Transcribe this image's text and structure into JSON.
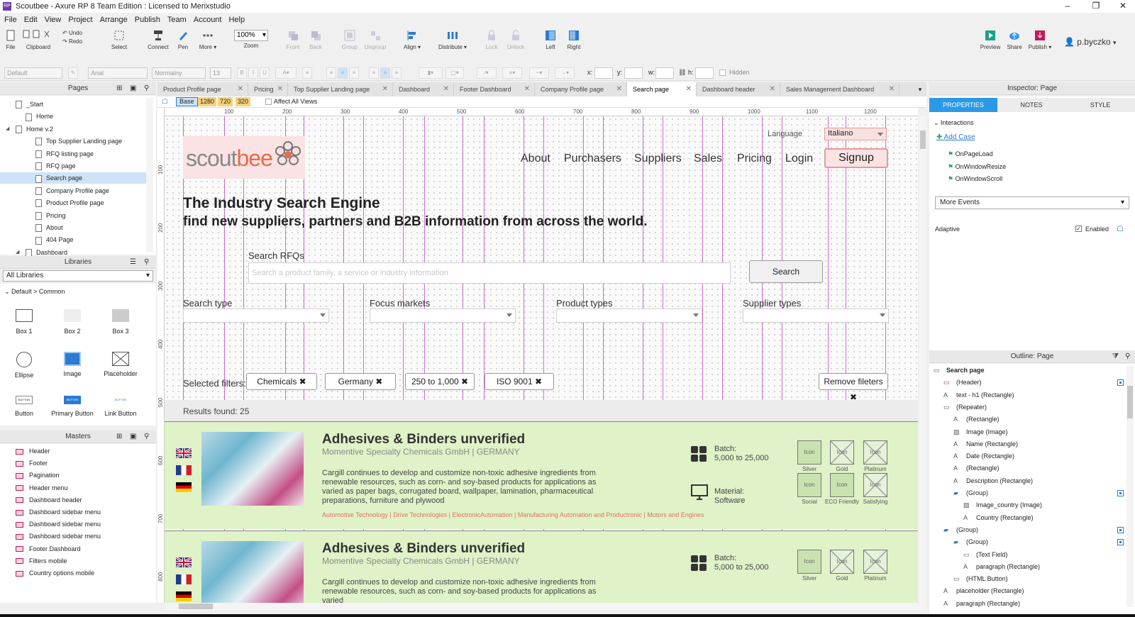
{
  "window": {
    "title": "Scoutbee - Axure RP 8 Team Edition : Licensed to Merixstudio",
    "minimize": "–",
    "restore": "❐",
    "close": "✕"
  },
  "menu": [
    "File",
    "Edit",
    "View",
    "Project",
    "Arrange",
    "Publish",
    "Team",
    "Account",
    "Help"
  ],
  "toolbar": {
    "file": "File",
    "clipboard": "Clipboard",
    "undo": "Undo",
    "redo": "Redo",
    "select": "Select",
    "connect": "Connect",
    "pen": "Pen",
    "more": "More ▾",
    "zoom_value": "100%",
    "zoom": "Zoom",
    "front": "Front",
    "back": "Back",
    "group": "Group",
    "ungroup": "Ungroup",
    "align": "Align ▾",
    "distribute": "Distribute ▾",
    "lock": "Lock",
    "unlock": "Unlock",
    "left": "Left",
    "right": "Right",
    "preview": "Preview",
    "share": "Share",
    "publish": "Publish ▾",
    "user": "p.byczko"
  },
  "format": {
    "style": "Default",
    "font": "Arial",
    "weight": "Normalny",
    "size": "13",
    "x": "x:",
    "y": "y:",
    "w": "w:",
    "h": "h:",
    "hidden": "Hidden"
  },
  "pages": {
    "title": "Pages",
    "items": [
      "_Start",
      "Home",
      "Home v.2",
      "Top Supplier Landing page",
      "RFQ listing page",
      "RFQ page",
      "Search page",
      "Company Profile page",
      "Product Profile page",
      "Pricing",
      "About",
      "404 Page",
      "Dashboard"
    ],
    "selected": "Search page"
  },
  "libraries": {
    "title": "Libraries",
    "select": "All Libraries",
    "group": "Default > Common",
    "items": [
      "Box 1",
      "Box 2",
      "Box 3",
      "Ellipse",
      "Image",
      "Placeholder",
      "Button",
      "Primary Button",
      "Link Button"
    ],
    "button_text": "BUTTON"
  },
  "masters": {
    "title": "Masters",
    "items": [
      "Header",
      "Footer",
      "Pagination",
      "Header menu",
      "Dashboard header",
      "Dashboard sidebar menu",
      "Dashboard sidebar menu",
      "Dashboard sidebar menu",
      "Footer Dashboard",
      "Filters mobile",
      "Country options mobile"
    ]
  },
  "tabs": [
    "Product Profile page",
    "Pricing",
    "Top Supplier Landing page",
    "Dashboard",
    "Footer Dashboard",
    "Company Profile page",
    "Search page",
    "Dashboard header",
    "Sales Management Dashboard"
  ],
  "active_tab": "Search page",
  "views": {
    "base": "Base",
    "v1": "1280",
    "v2": "720",
    "v3": "320",
    "affect": "Affect All Views"
  },
  "ruler_h": [
    "100",
    "200",
    "300",
    "400",
    "500",
    "600",
    "700",
    "800",
    "900",
    "1000",
    "1100",
    "1200"
  ],
  "ruler_v": [
    "100",
    "200",
    "300",
    "400",
    "500",
    "600",
    "700",
    "800"
  ],
  "page": {
    "language_label": "Language",
    "language_value": "Italiano",
    "logo_a": "scout",
    "logo_b": "bee",
    "nav": [
      "About",
      "Purchasers",
      "Suppliers",
      "Sales",
      "Pricing",
      "Login"
    ],
    "signup": "Signup",
    "h1": "The Industry Search Engine",
    "h2": "find new suppliers, partners and B2B information from across the world.",
    "search_label": "Search RFQs",
    "search_placeholder": "Search a product family, a service or industry information",
    "search_button": "Search",
    "filters": [
      "Search type",
      "Focus markets",
      "Product types",
      "Supplier types"
    ],
    "selected_filters_label": "Selected filters:",
    "chips": [
      "Chemicals ✖",
      "Germany ✖",
      "250 to 1,000 ✖",
      "ISO 9001 ✖"
    ],
    "remove_filters": "Remove fileters ✖",
    "results_found": "Results found: 25",
    "results": [
      {
        "title": "Adhesives & Binders unverified",
        "company": "Momentive Specialty Chemicals GmbH | GERMANY",
        "description": "Cargill continues to develop and customize non-toxic adhesive ingredients from renewable resources, such as corn- and soy-based products for applications as varied as paper bags, corrugated board, wallpaper, lamination, pharmaceutical preparations, furniture and plywood",
        "tags": "Automotive Technology | Drive Technologies | ElectronicAutomation | Manufacturing Automation and Productronic | Motors and Engines",
        "batch_label": "Batch:",
        "batch_value": "5,000 to 25,000",
        "material_label": "Material:",
        "material_value": "Software",
        "badges": [
          "Silver",
          "Gold",
          "Platinum",
          "Social",
          "ECO Friendly",
          "Satisfying"
        ],
        "icon_text": "Icon"
      },
      {
        "title": "Adhesives & Binders unverified",
        "company": "Momentive Specialty Chemicals GmbH | GERMANY",
        "description": "Cargill continues to develop and customize non-toxic adhesive ingredients from renewable resources, such as corn- and soy-based products for applications as varied",
        "batch_label": "Batch:",
        "batch_value": "5,000 to 25,000",
        "badges": [
          "Silver",
          "Gold",
          "Platinum"
        ],
        "icon_text": "Icon"
      }
    ]
  },
  "inspector": {
    "title": "Inspector: Page",
    "tabs": [
      "PROPERTIES",
      "NOTES",
      "STYLE"
    ],
    "interactions": "Interactions",
    "add_case": "Add Case",
    "events": [
      "OnPageLoad",
      "OnWindowResize",
      "OnWindowScroll"
    ],
    "more_events": "More Events",
    "adaptive": "Adaptive",
    "enabled": "Enabled"
  },
  "outline": {
    "title": "Outline: Page",
    "items": [
      {
        "label": "Search page",
        "indent": 0
      },
      {
        "label": "(Header)",
        "indent": 1
      },
      {
        "label": "text - h1 (Rectangle)",
        "indent": 1
      },
      {
        "label": "(Repeater)",
        "indent": 1
      },
      {
        "label": "(Rectangle)",
        "indent": 2
      },
      {
        "label": "Image (Image)",
        "indent": 2
      },
      {
        "label": "Name (Rectangle)",
        "indent": 2
      },
      {
        "label": "Date (Rectangle)",
        "indent": 2
      },
      {
        "label": "(Rectangle)",
        "indent": 2
      },
      {
        "label": "Description (Rectangle)",
        "indent": 2
      },
      {
        "label": "(Group)",
        "indent": 2
      },
      {
        "label": "Image_country (Image)",
        "indent": 3
      },
      {
        "label": "Country (Rectangle)",
        "indent": 3
      },
      {
        "label": "(Group)",
        "indent": 1
      },
      {
        "label": "(Group)",
        "indent": 2
      },
      {
        "label": "(Text Field)",
        "indent": 3
      },
      {
        "label": "paragraph (Rectangle)",
        "indent": 3
      },
      {
        "label": "(HTML Button)",
        "indent": 2
      },
      {
        "label": "placeholder (Rectangle)",
        "indent": 1
      },
      {
        "label": "paragraph (Rectangle)",
        "indent": 1
      }
    ]
  },
  "colors": {
    "accent": "#2b7bd1",
    "guide": "#c454c4",
    "result_bg": "#dff2c8",
    "logo_pink": "#e86a4c"
  }
}
